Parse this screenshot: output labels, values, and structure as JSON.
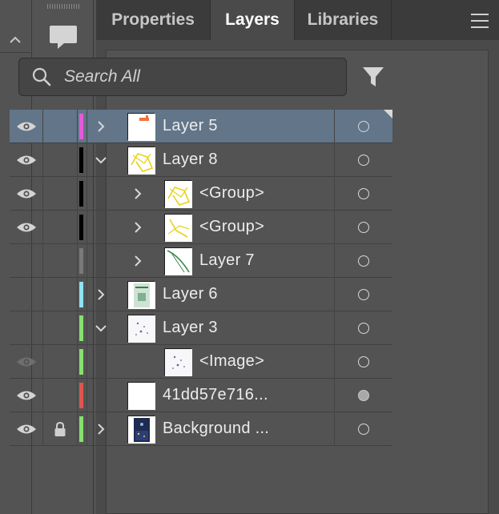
{
  "tabs": [
    {
      "label": "Properties",
      "active": false
    },
    {
      "label": "Layers",
      "active": true
    },
    {
      "label": "Libraries",
      "active": false
    }
  ],
  "search": {
    "placeholder": "Search All",
    "value": ""
  },
  "icons": {
    "collapse": "chevron-up-icon",
    "comments": "speech-bubble-icon",
    "search": "magnifier-icon",
    "filter": "funnel-icon",
    "menu": "hamburger-menu-icon",
    "visibility": "eye-icon",
    "lock": "lock-icon"
  },
  "layers": [
    {
      "name": "Layer 5",
      "visible": true,
      "eye_dim": false,
      "locked": false,
      "color": "#e55ad8",
      "indent": 0,
      "toggle": "collapsed",
      "thumb": "layer5",
      "target_filled": false,
      "selected": true
    },
    {
      "name": "Layer 8",
      "visible": true,
      "eye_dim": false,
      "locked": false,
      "color": "#000000",
      "indent": 0,
      "toggle": "expanded",
      "thumb": "yellow-lines",
      "target_filled": false,
      "selected": false
    },
    {
      "name": "<Group>",
      "visible": true,
      "eye_dim": false,
      "locked": false,
      "color": "#000000",
      "indent": 1,
      "toggle": "collapsed",
      "thumb": "yellow-lines",
      "target_filled": false,
      "selected": false
    },
    {
      "name": "<Group>",
      "visible": true,
      "eye_dim": false,
      "locked": false,
      "color": "#000000",
      "indent": 1,
      "toggle": "collapsed",
      "thumb": "yellow-lines-2",
      "target_filled": false,
      "selected": false
    },
    {
      "name": "Layer 7",
      "visible": false,
      "eye_dim": false,
      "locked": false,
      "color": "#7a7a7a",
      "indent": 1,
      "toggle": "collapsed",
      "thumb": "green-curve",
      "target_filled": false,
      "selected": false
    },
    {
      "name": "Layer 6",
      "visible": false,
      "eye_dim": false,
      "locked": false,
      "color": "#8fe3f2",
      "indent": 0,
      "toggle": "collapsed",
      "thumb": "greenish",
      "target_filled": false,
      "selected": false
    },
    {
      "name": "Layer 3",
      "visible": false,
      "eye_dim": false,
      "locked": false,
      "color": "#86e070",
      "indent": 0,
      "toggle": "expanded",
      "thumb": "dots",
      "target_filled": false,
      "selected": false
    },
    {
      "name": "<Image>",
      "visible": true,
      "eye_dim": true,
      "locked": false,
      "color": "#86e070",
      "indent": 1,
      "toggle": "none",
      "thumb": "dots",
      "target_filled": false,
      "selected": false
    },
    {
      "name": "41dd57e716...",
      "visible": true,
      "eye_dim": false,
      "locked": false,
      "color": "#e0564e",
      "indent": 0,
      "toggle": "none",
      "thumb": "blank",
      "target_filled": true,
      "selected": false
    },
    {
      "name": "Background ...",
      "visible": true,
      "eye_dim": false,
      "locked": true,
      "color": "#86e070",
      "indent": 0,
      "toggle": "collapsed",
      "thumb": "photo",
      "target_filled": false,
      "selected": false
    }
  ]
}
